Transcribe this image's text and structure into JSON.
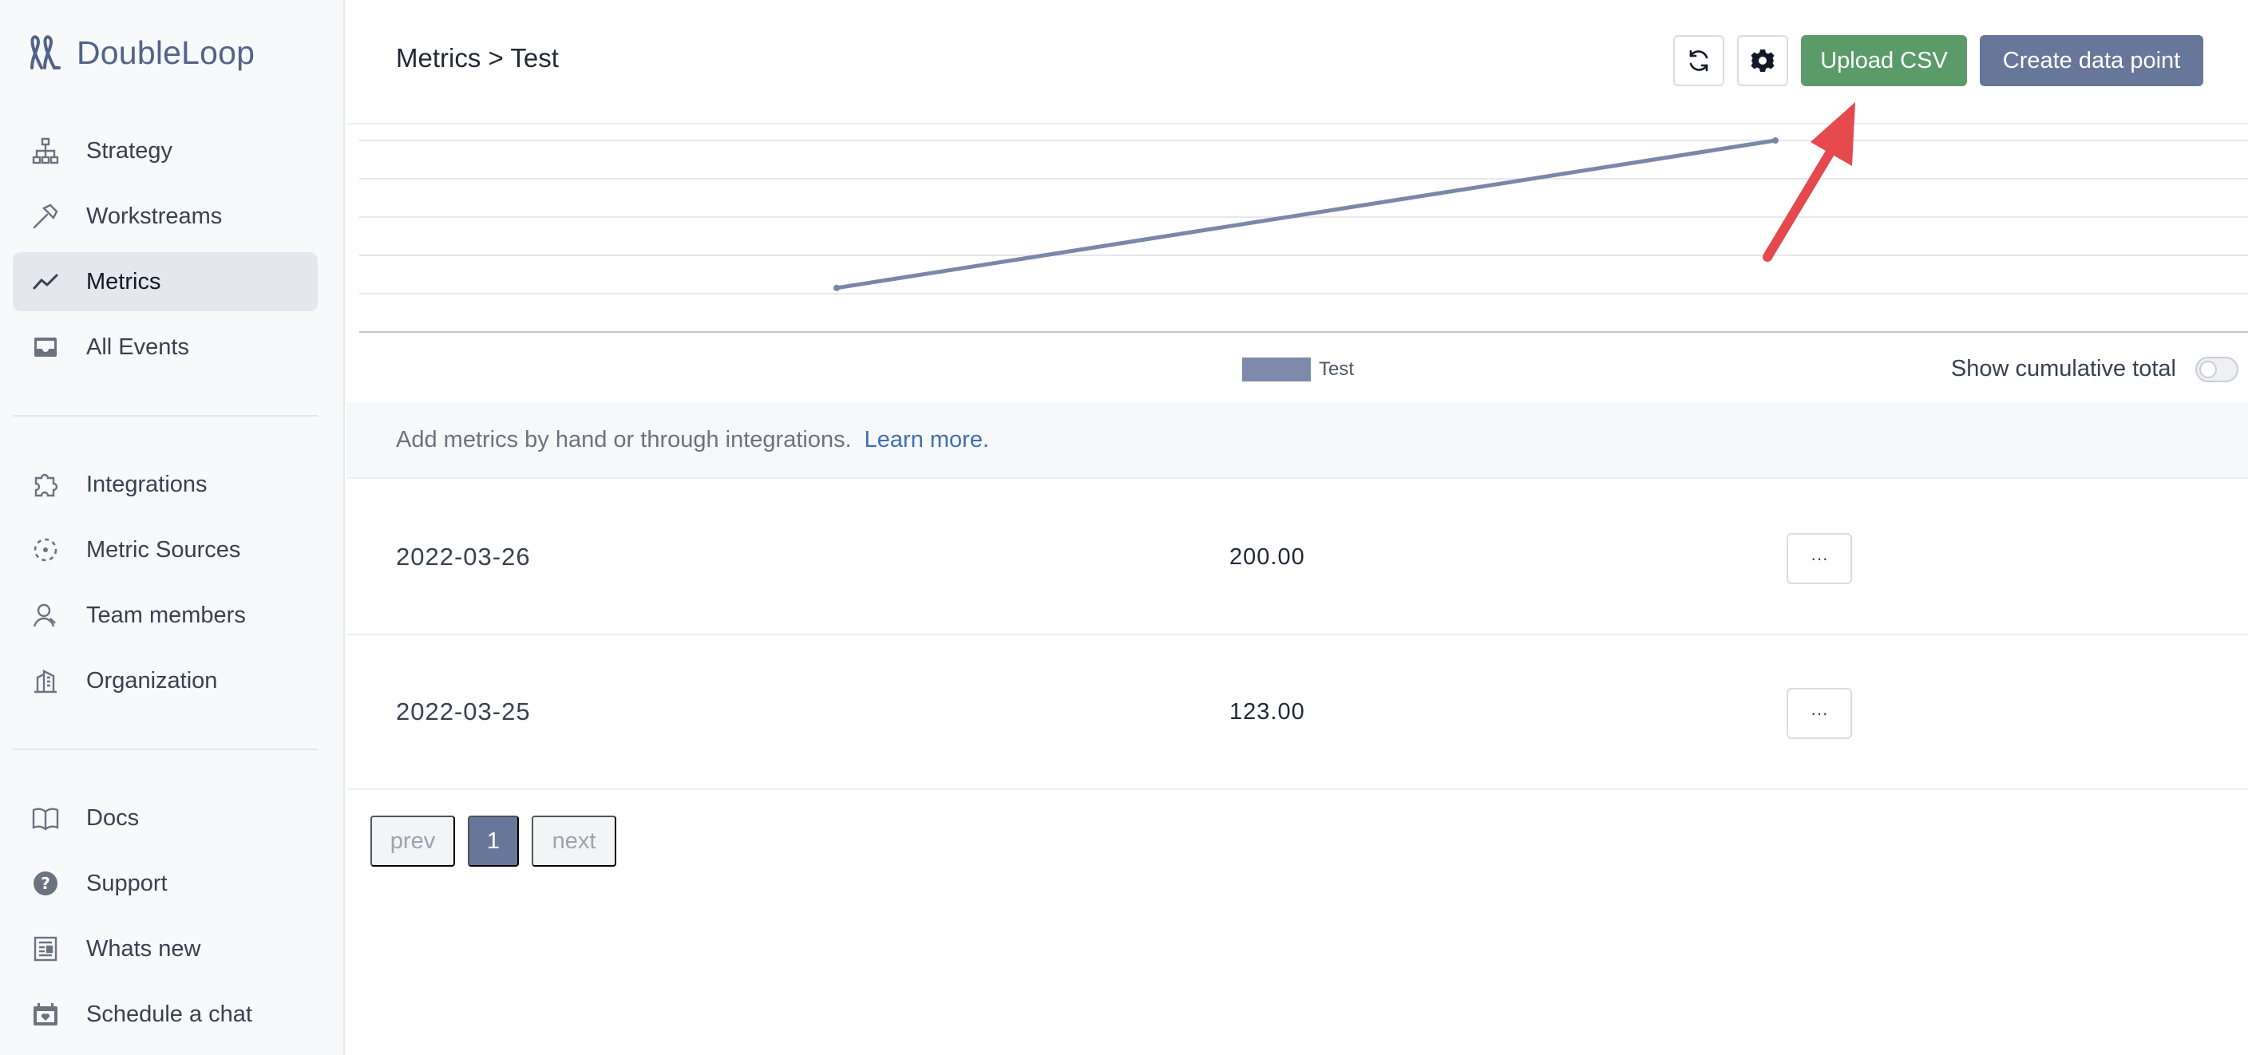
{
  "brand": {
    "name": "DoubleLoop"
  },
  "sidebar": {
    "primary": [
      {
        "label": "Strategy",
        "icon": "sitemap-icon",
        "active": false
      },
      {
        "label": "Workstreams",
        "icon": "hammer-icon",
        "active": false
      },
      {
        "label": "Metrics",
        "icon": "trend-line-icon",
        "active": true
      },
      {
        "label": "All Events",
        "icon": "inbox-icon",
        "active": false
      }
    ],
    "secondary": [
      {
        "label": "Integrations",
        "icon": "puzzle-icon"
      },
      {
        "label": "Metric Sources",
        "icon": "dashed-circle-icon"
      },
      {
        "label": "Team members",
        "icon": "user-icon"
      },
      {
        "label": "Organization",
        "icon": "building-icon"
      }
    ],
    "tertiary": [
      {
        "label": "Docs",
        "icon": "book-icon"
      },
      {
        "label": "Support",
        "icon": "question-circle-icon"
      },
      {
        "label": "Whats new",
        "icon": "newspaper-icon"
      },
      {
        "label": "Schedule a chat",
        "icon": "calendar-heart-icon"
      }
    ]
  },
  "header": {
    "breadcrumb": "Metrics > Test",
    "refresh_icon": "refresh-icon",
    "settings_icon": "gear-icon",
    "upload_label": "Upload CSV",
    "create_label": "Create data point"
  },
  "chart_data": {
    "type": "line",
    "x": [
      "2022-03-25",
      "2022-03-26"
    ],
    "series": [
      {
        "name": "Test",
        "values": [
          123.0,
          200.0
        ]
      }
    ],
    "grid": true,
    "legend": "bottom-center"
  },
  "chart": {
    "legend_label": "Test",
    "cumulative_label": "Show cumulative total",
    "cumulative_on": false,
    "line_color": "#7a87a8"
  },
  "info": {
    "text": "Add metrics by hand or through integrations.",
    "link": "Learn more."
  },
  "rows": [
    {
      "date": "2022-03-26",
      "value": "200.00",
      "menu": "···"
    },
    {
      "date": "2022-03-25",
      "value": "123.00",
      "menu": "···"
    }
  ],
  "pagination": {
    "prev": "prev",
    "current": "1",
    "next": "next"
  },
  "colors": {
    "accent_green": "#5b9b6a",
    "accent_slate": "#66779a",
    "annotation_red": "#e5484d"
  }
}
